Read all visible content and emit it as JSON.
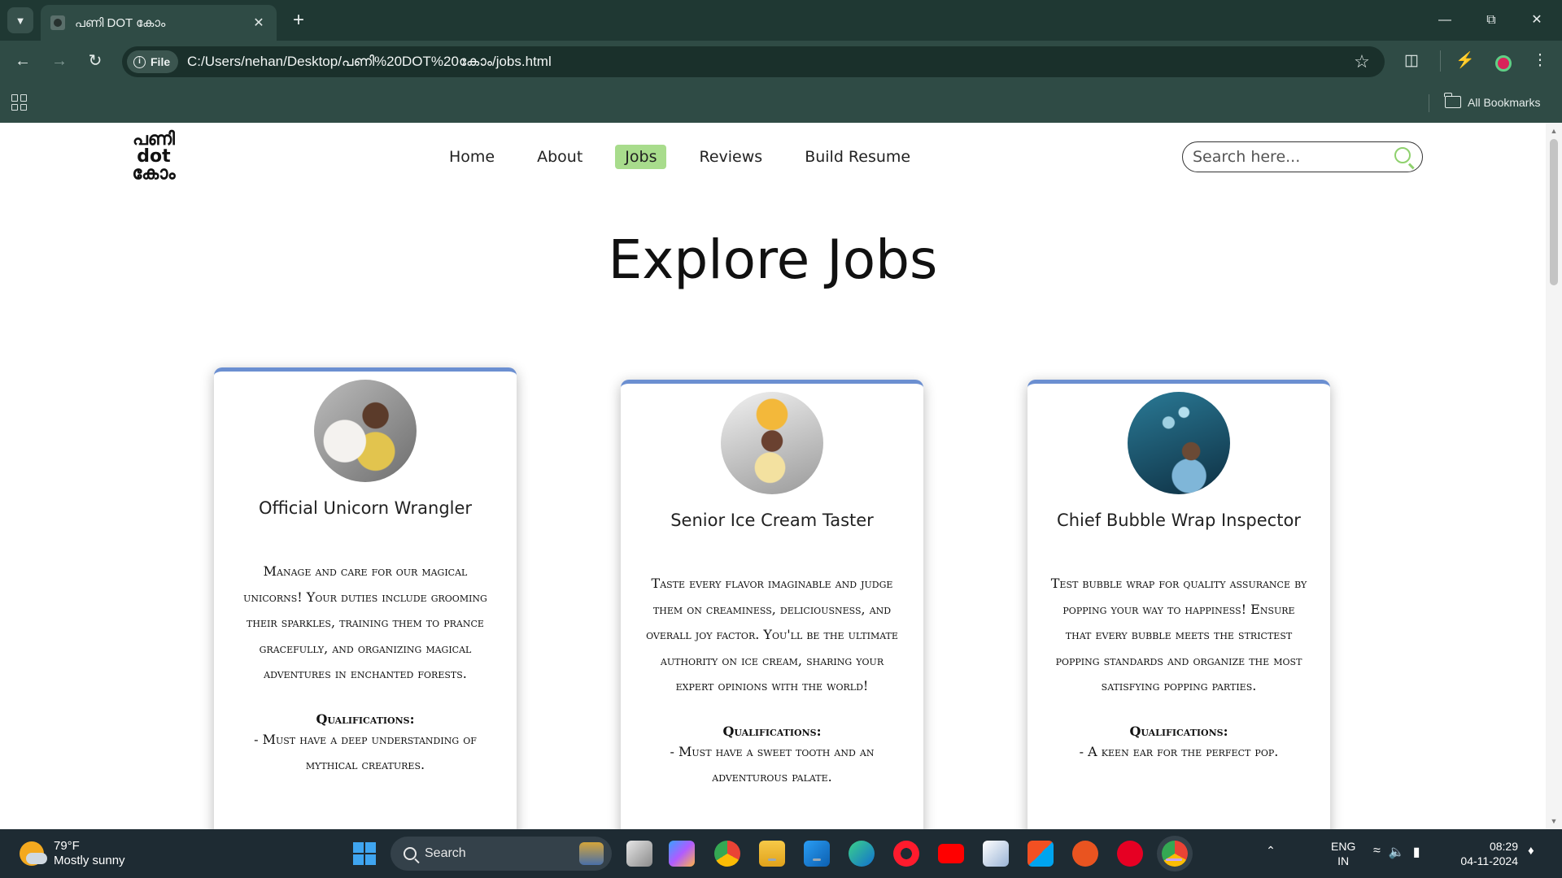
{
  "browser": {
    "tab_title": "പണി DOT കോം",
    "new_tab": "+",
    "url_scheme_label": "File",
    "url": "C:/Users/nehan/Desktop/പണി%20DOT%20കോം/jobs.html",
    "all_bookmarks": "All Bookmarks"
  },
  "site": {
    "logo": {
      "line1": "പണി",
      "line2": "dot",
      "line3": "കോം"
    },
    "nav": [
      {
        "label": "Home"
      },
      {
        "label": "About"
      },
      {
        "label": "Jobs",
        "active": true
      },
      {
        "label": "Reviews"
      },
      {
        "label": "Build Resume"
      }
    ],
    "search_placeholder": "Search here...",
    "page_title": "Explore Jobs",
    "accent_color": "#a8dc8c",
    "card_border_color": "#6b8fd1",
    "jobs": [
      {
        "title": "Official Unicorn Wrangler",
        "description": "Manage and care for our magical unicorns! Your duties include grooming their sparkles, training them to prance gracefully, and organizing magical adventures in enchanted forests.",
        "qualifications_heading": "Qualifications:",
        "qualification": "- Must have a deep understanding of mythical creatures."
      },
      {
        "title": "Senior Ice Cream Taster",
        "description": "Taste every flavor imaginable and judge them on creaminess, deliciousness, and overall joy factor. You'll be the ultimate authority on ice cream, sharing your expert opinions with the world!",
        "qualifications_heading": "Qualifications:",
        "qualification": "- Must have a sweet tooth and an adventurous palate."
      },
      {
        "title": "Chief Bubble Wrap Inspector",
        "description": "Test bubble wrap for quality assurance by popping your way to happiness! Ensure that every bubble meets the strictest popping standards and organize the most satisfying popping parties.",
        "qualifications_heading": "Qualifications:",
        "qualification": "- A keen ear for the perfect pop."
      }
    ]
  },
  "taskbar": {
    "weather_temp": "79°F",
    "weather_desc": "Mostly sunny",
    "search_label": "Search",
    "lang_line1": "ENG",
    "lang_line2": "IN",
    "time": "08:29",
    "date": "04-11-2024"
  }
}
